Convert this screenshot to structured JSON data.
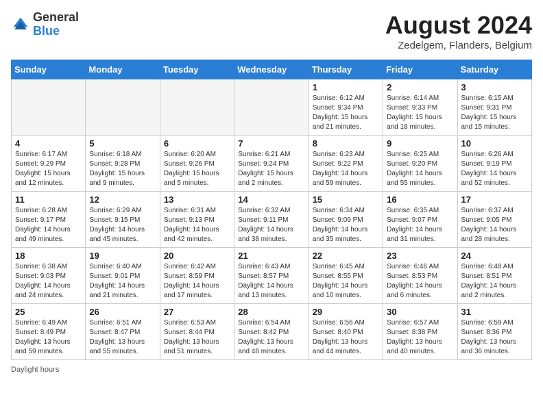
{
  "header": {
    "logo_general": "General",
    "logo_blue": "Blue",
    "month_year": "August 2024",
    "location": "Zedelgem, Flanders, Belgium"
  },
  "days_of_week": [
    "Sunday",
    "Monday",
    "Tuesday",
    "Wednesday",
    "Thursday",
    "Friday",
    "Saturday"
  ],
  "footer": {
    "daylight_hours": "Daylight hours"
  },
  "weeks": [
    [
      {
        "day": "",
        "empty": true
      },
      {
        "day": "",
        "empty": true
      },
      {
        "day": "",
        "empty": true
      },
      {
        "day": "",
        "empty": true
      },
      {
        "day": "1",
        "sunrise": "Sunrise: 6:12 AM",
        "sunset": "Sunset: 9:34 PM",
        "daylight": "Daylight: 15 hours and 21 minutes."
      },
      {
        "day": "2",
        "sunrise": "Sunrise: 6:14 AM",
        "sunset": "Sunset: 9:33 PM",
        "daylight": "Daylight: 15 hours and 18 minutes."
      },
      {
        "day": "3",
        "sunrise": "Sunrise: 6:15 AM",
        "sunset": "Sunset: 9:31 PM",
        "daylight": "Daylight: 15 hours and 15 minutes."
      }
    ],
    [
      {
        "day": "4",
        "sunrise": "Sunrise: 6:17 AM",
        "sunset": "Sunset: 9:29 PM",
        "daylight": "Daylight: 15 hours and 12 minutes."
      },
      {
        "day": "5",
        "sunrise": "Sunrise: 6:18 AM",
        "sunset": "Sunset: 9:28 PM",
        "daylight": "Daylight: 15 hours and 9 minutes."
      },
      {
        "day": "6",
        "sunrise": "Sunrise: 6:20 AM",
        "sunset": "Sunset: 9:26 PM",
        "daylight": "Daylight: 15 hours and 5 minutes."
      },
      {
        "day": "7",
        "sunrise": "Sunrise: 6:21 AM",
        "sunset": "Sunset: 9:24 PM",
        "daylight": "Daylight: 15 hours and 2 minutes."
      },
      {
        "day": "8",
        "sunrise": "Sunrise: 6:23 AM",
        "sunset": "Sunset: 9:22 PM",
        "daylight": "Daylight: 14 hours and 59 minutes."
      },
      {
        "day": "9",
        "sunrise": "Sunrise: 6:25 AM",
        "sunset": "Sunset: 9:20 PM",
        "daylight": "Daylight: 14 hours and 55 minutes."
      },
      {
        "day": "10",
        "sunrise": "Sunrise: 6:26 AM",
        "sunset": "Sunset: 9:19 PM",
        "daylight": "Daylight: 14 hours and 52 minutes."
      }
    ],
    [
      {
        "day": "11",
        "sunrise": "Sunrise: 6:28 AM",
        "sunset": "Sunset: 9:17 PM",
        "daylight": "Daylight: 14 hours and 49 minutes."
      },
      {
        "day": "12",
        "sunrise": "Sunrise: 6:29 AM",
        "sunset": "Sunset: 9:15 PM",
        "daylight": "Daylight: 14 hours and 45 minutes."
      },
      {
        "day": "13",
        "sunrise": "Sunrise: 6:31 AM",
        "sunset": "Sunset: 9:13 PM",
        "daylight": "Daylight: 14 hours and 42 minutes."
      },
      {
        "day": "14",
        "sunrise": "Sunrise: 6:32 AM",
        "sunset": "Sunset: 9:11 PM",
        "daylight": "Daylight: 14 hours and 38 minutes."
      },
      {
        "day": "15",
        "sunrise": "Sunrise: 6:34 AM",
        "sunset": "Sunset: 9:09 PM",
        "daylight": "Daylight: 14 hours and 35 minutes."
      },
      {
        "day": "16",
        "sunrise": "Sunrise: 6:35 AM",
        "sunset": "Sunset: 9:07 PM",
        "daylight": "Daylight: 14 hours and 31 minutes."
      },
      {
        "day": "17",
        "sunrise": "Sunrise: 6:37 AM",
        "sunset": "Sunset: 9:05 PM",
        "daylight": "Daylight: 14 hours and 28 minutes."
      }
    ],
    [
      {
        "day": "18",
        "sunrise": "Sunrise: 6:38 AM",
        "sunset": "Sunset: 9:03 PM",
        "daylight": "Daylight: 14 hours and 24 minutes."
      },
      {
        "day": "19",
        "sunrise": "Sunrise: 6:40 AM",
        "sunset": "Sunset: 9:01 PM",
        "daylight": "Daylight: 14 hours and 21 minutes."
      },
      {
        "day": "20",
        "sunrise": "Sunrise: 6:42 AM",
        "sunset": "Sunset: 8:59 PM",
        "daylight": "Daylight: 14 hours and 17 minutes."
      },
      {
        "day": "21",
        "sunrise": "Sunrise: 6:43 AM",
        "sunset": "Sunset: 8:57 PM",
        "daylight": "Daylight: 14 hours and 13 minutes."
      },
      {
        "day": "22",
        "sunrise": "Sunrise: 6:45 AM",
        "sunset": "Sunset: 8:55 PM",
        "daylight": "Daylight: 14 hours and 10 minutes."
      },
      {
        "day": "23",
        "sunrise": "Sunrise: 6:46 AM",
        "sunset": "Sunset: 8:53 PM",
        "daylight": "Daylight: 14 hours and 6 minutes."
      },
      {
        "day": "24",
        "sunrise": "Sunrise: 6:48 AM",
        "sunset": "Sunset: 8:51 PM",
        "daylight": "Daylight: 14 hours and 2 minutes."
      }
    ],
    [
      {
        "day": "25",
        "sunrise": "Sunrise: 6:49 AM",
        "sunset": "Sunset: 8:49 PM",
        "daylight": "Daylight: 13 hours and 59 minutes."
      },
      {
        "day": "26",
        "sunrise": "Sunrise: 6:51 AM",
        "sunset": "Sunset: 8:47 PM",
        "daylight": "Daylight: 13 hours and 55 minutes."
      },
      {
        "day": "27",
        "sunrise": "Sunrise: 6:53 AM",
        "sunset": "Sunset: 8:44 PM",
        "daylight": "Daylight: 13 hours and 51 minutes."
      },
      {
        "day": "28",
        "sunrise": "Sunrise: 6:54 AM",
        "sunset": "Sunset: 8:42 PM",
        "daylight": "Daylight: 13 hours and 48 minutes."
      },
      {
        "day": "29",
        "sunrise": "Sunrise: 6:56 AM",
        "sunset": "Sunset: 8:40 PM",
        "daylight": "Daylight: 13 hours and 44 minutes."
      },
      {
        "day": "30",
        "sunrise": "Sunrise: 6:57 AM",
        "sunset": "Sunset: 8:38 PM",
        "daylight": "Daylight: 13 hours and 40 minutes."
      },
      {
        "day": "31",
        "sunrise": "Sunrise: 6:59 AM",
        "sunset": "Sunset: 8:36 PM",
        "daylight": "Daylight: 13 hours and 36 minutes."
      }
    ]
  ]
}
